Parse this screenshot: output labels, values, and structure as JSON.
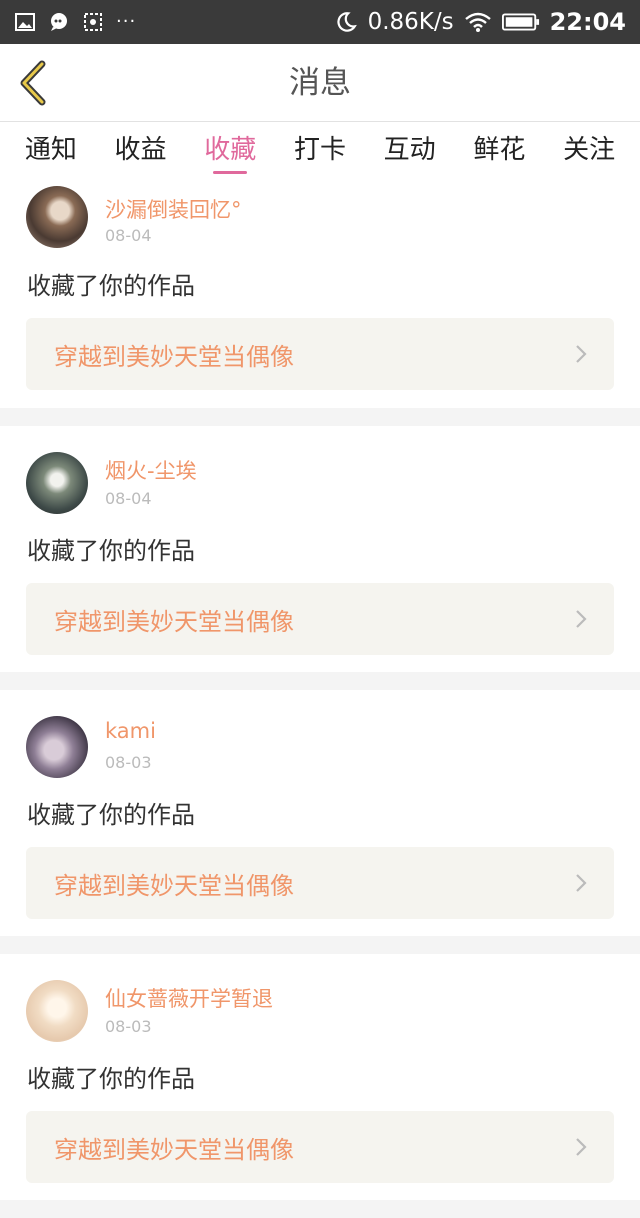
{
  "status_bar": {
    "icons": [
      "image-icon",
      "chat-bubble-icon",
      "screenshot-icon"
    ],
    "more": "···",
    "speed": "0.86K/s",
    "time": "22:04"
  },
  "header": {
    "title": "消息"
  },
  "tabs": [
    {
      "label": "通知",
      "active": false
    },
    {
      "label": "收益",
      "active": false
    },
    {
      "label": "收藏",
      "active": true
    },
    {
      "label": "打卡",
      "active": false
    },
    {
      "label": "互动",
      "active": false
    },
    {
      "label": "鲜花",
      "active": false
    },
    {
      "label": "关注",
      "active": false
    }
  ],
  "messages": [
    {
      "user": "沙漏倒装回忆°",
      "date": "08-04",
      "action": "收藏了你的作品",
      "work": "穿越到美妙天堂当偶像"
    },
    {
      "user": "烟火-尘埃",
      "date": "08-04",
      "action": "收藏了你的作品",
      "work": "穿越到美妙天堂当偶像"
    },
    {
      "user": "kami",
      "date": "08-03",
      "action": "收藏了你的作品",
      "work": "穿越到美妙天堂当偶像"
    },
    {
      "user": "仙女蔷薇开学暂退",
      "date": "08-03",
      "action": "收藏了你的作品",
      "work": "穿越到美妙天堂当偶像"
    }
  ],
  "colors": {
    "accent": "#e0699c",
    "username": "#f0966a",
    "work_bg": "#f5f4ef",
    "statusbar": "#3a3a3a"
  }
}
